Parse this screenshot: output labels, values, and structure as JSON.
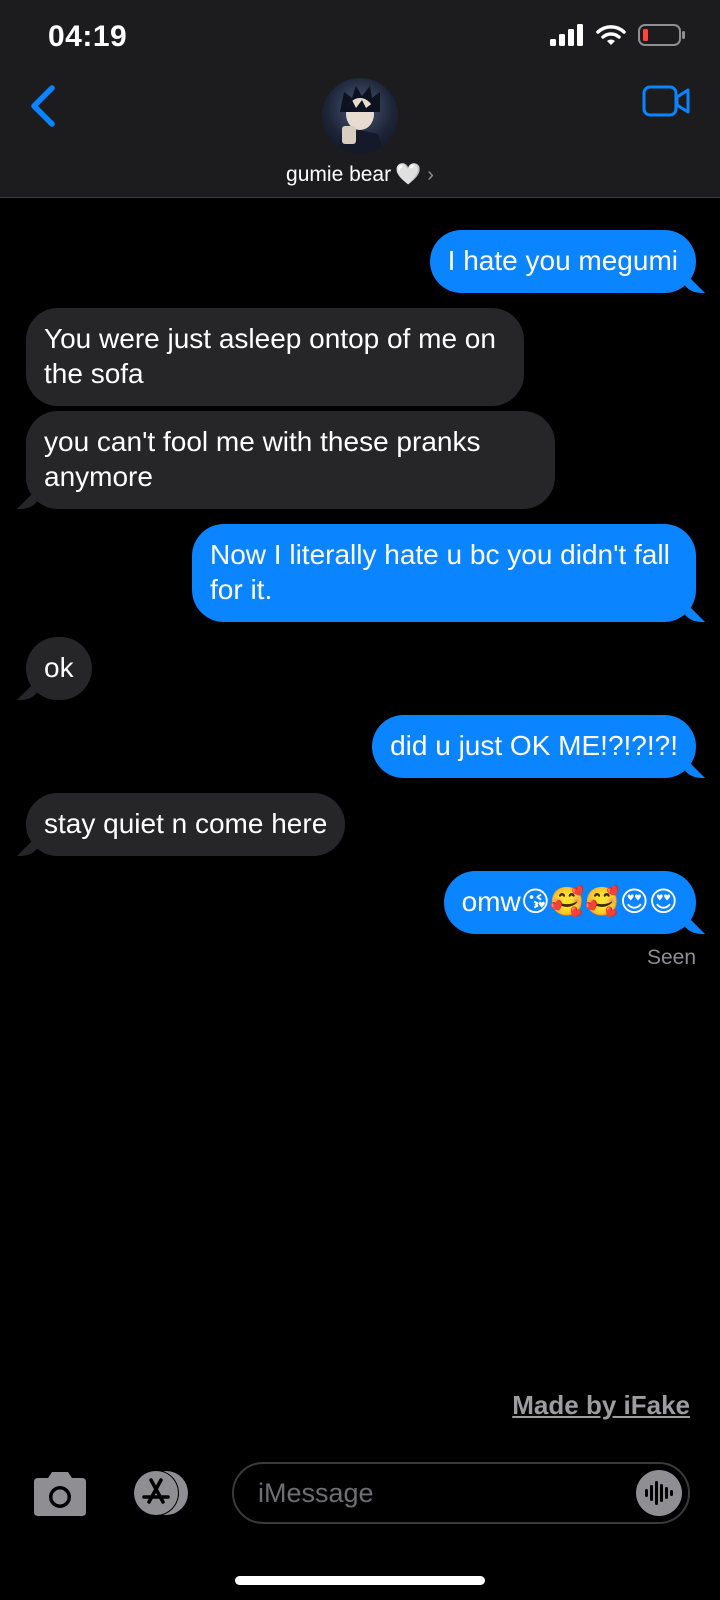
{
  "status": {
    "time": "04:19"
  },
  "contact": {
    "name": "gumie bear",
    "heart": "🤍",
    "chevron": "›"
  },
  "messages": [
    {
      "text": "I hate you megumi",
      "direction": "outgoing"
    },
    {
      "text": "You were just asleep ontop of me on the sofa",
      "direction": "incoming"
    },
    {
      "text": "you can't fool me with these pranks anymore",
      "direction": "incoming"
    },
    {
      "text": "Now I literally hate u bc you didn't fall for it.",
      "direction": "outgoing"
    },
    {
      "text": "ok",
      "direction": "incoming"
    },
    {
      "text": "did u just OK ME!?!?!?!",
      "direction": "outgoing"
    },
    {
      "text": "stay quiet n come here",
      "direction": "incoming"
    },
    {
      "text": "omw😘🥰🥰😍😍",
      "direction": "outgoing"
    }
  ],
  "receipt": "Seen",
  "watermark": "Made by iFake",
  "composer": {
    "placeholder": "iMessage"
  },
  "colors": {
    "outgoing_bubble": "#0a84ff",
    "incoming_bubble": "#262628",
    "accent": "#0a84ff",
    "background": "#000000"
  },
  "icons": [
    "back-chevron-icon",
    "video-camera-icon",
    "signal-icon",
    "wifi-icon",
    "battery-icon",
    "camera-icon",
    "app-store-icon",
    "audio-waveform-icon"
  ]
}
